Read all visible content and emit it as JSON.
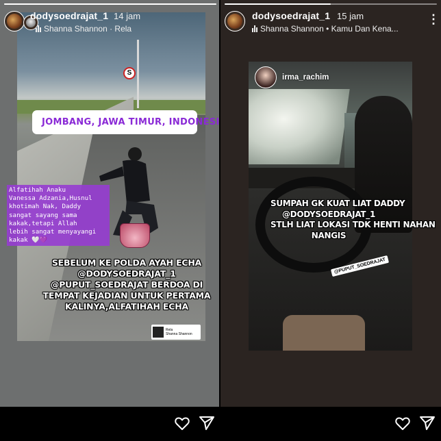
{
  "left_story": {
    "username": "dodysoedrajat_1",
    "time": "14 jam",
    "music": "Shanna Shannon · Rela",
    "location_sticker": "JOMBANG, JAWA TIMUR, INDONESIA",
    "caption_purple": "Alfatihah Anaku\nVanessa Adzania,Husnul\nkhotimah Nak, Daddy\nsangat sayang sama\nkakak,tetapi Allah\nlebih sangat menyayangi\nkakak 🤍💜",
    "caption_main": "SEBELUM KE POLDA AYAH ECHA\n@DODYSOEDRAJAT_1\n@PUPUT_SOEDRAJAT BERDOA DI\nTEMPAT KEJADIAN UNTUK PERTAMA\nKALINYA,ALFATIHAH ECHA",
    "music_sticker_title": "Rela",
    "music_sticker_artist": "Shanna Shannon",
    "sign_text": "S",
    "progress": 1.0
  },
  "right_story": {
    "username": "dodysoedrajat_1",
    "time": "15 jam",
    "music": "Shanna Shannon • Kamu Dan Kena...",
    "mention_username": "irma_rachim",
    "caption_main": "SUMPAH GK KUAT LIAT DADDY\n@DODYSOEDRAJAT_1\nSTLH LIAT LOKASI TDK HENTI NAHAN\nNANGIS",
    "tag": "@PUPUT_SOEDRAJAT",
    "more_label": "⋮",
    "progress": 0.5
  },
  "icons": [
    "heart-icon",
    "send-icon",
    "music-bars-icon",
    "location-pin-icon",
    "more-icon"
  ]
}
